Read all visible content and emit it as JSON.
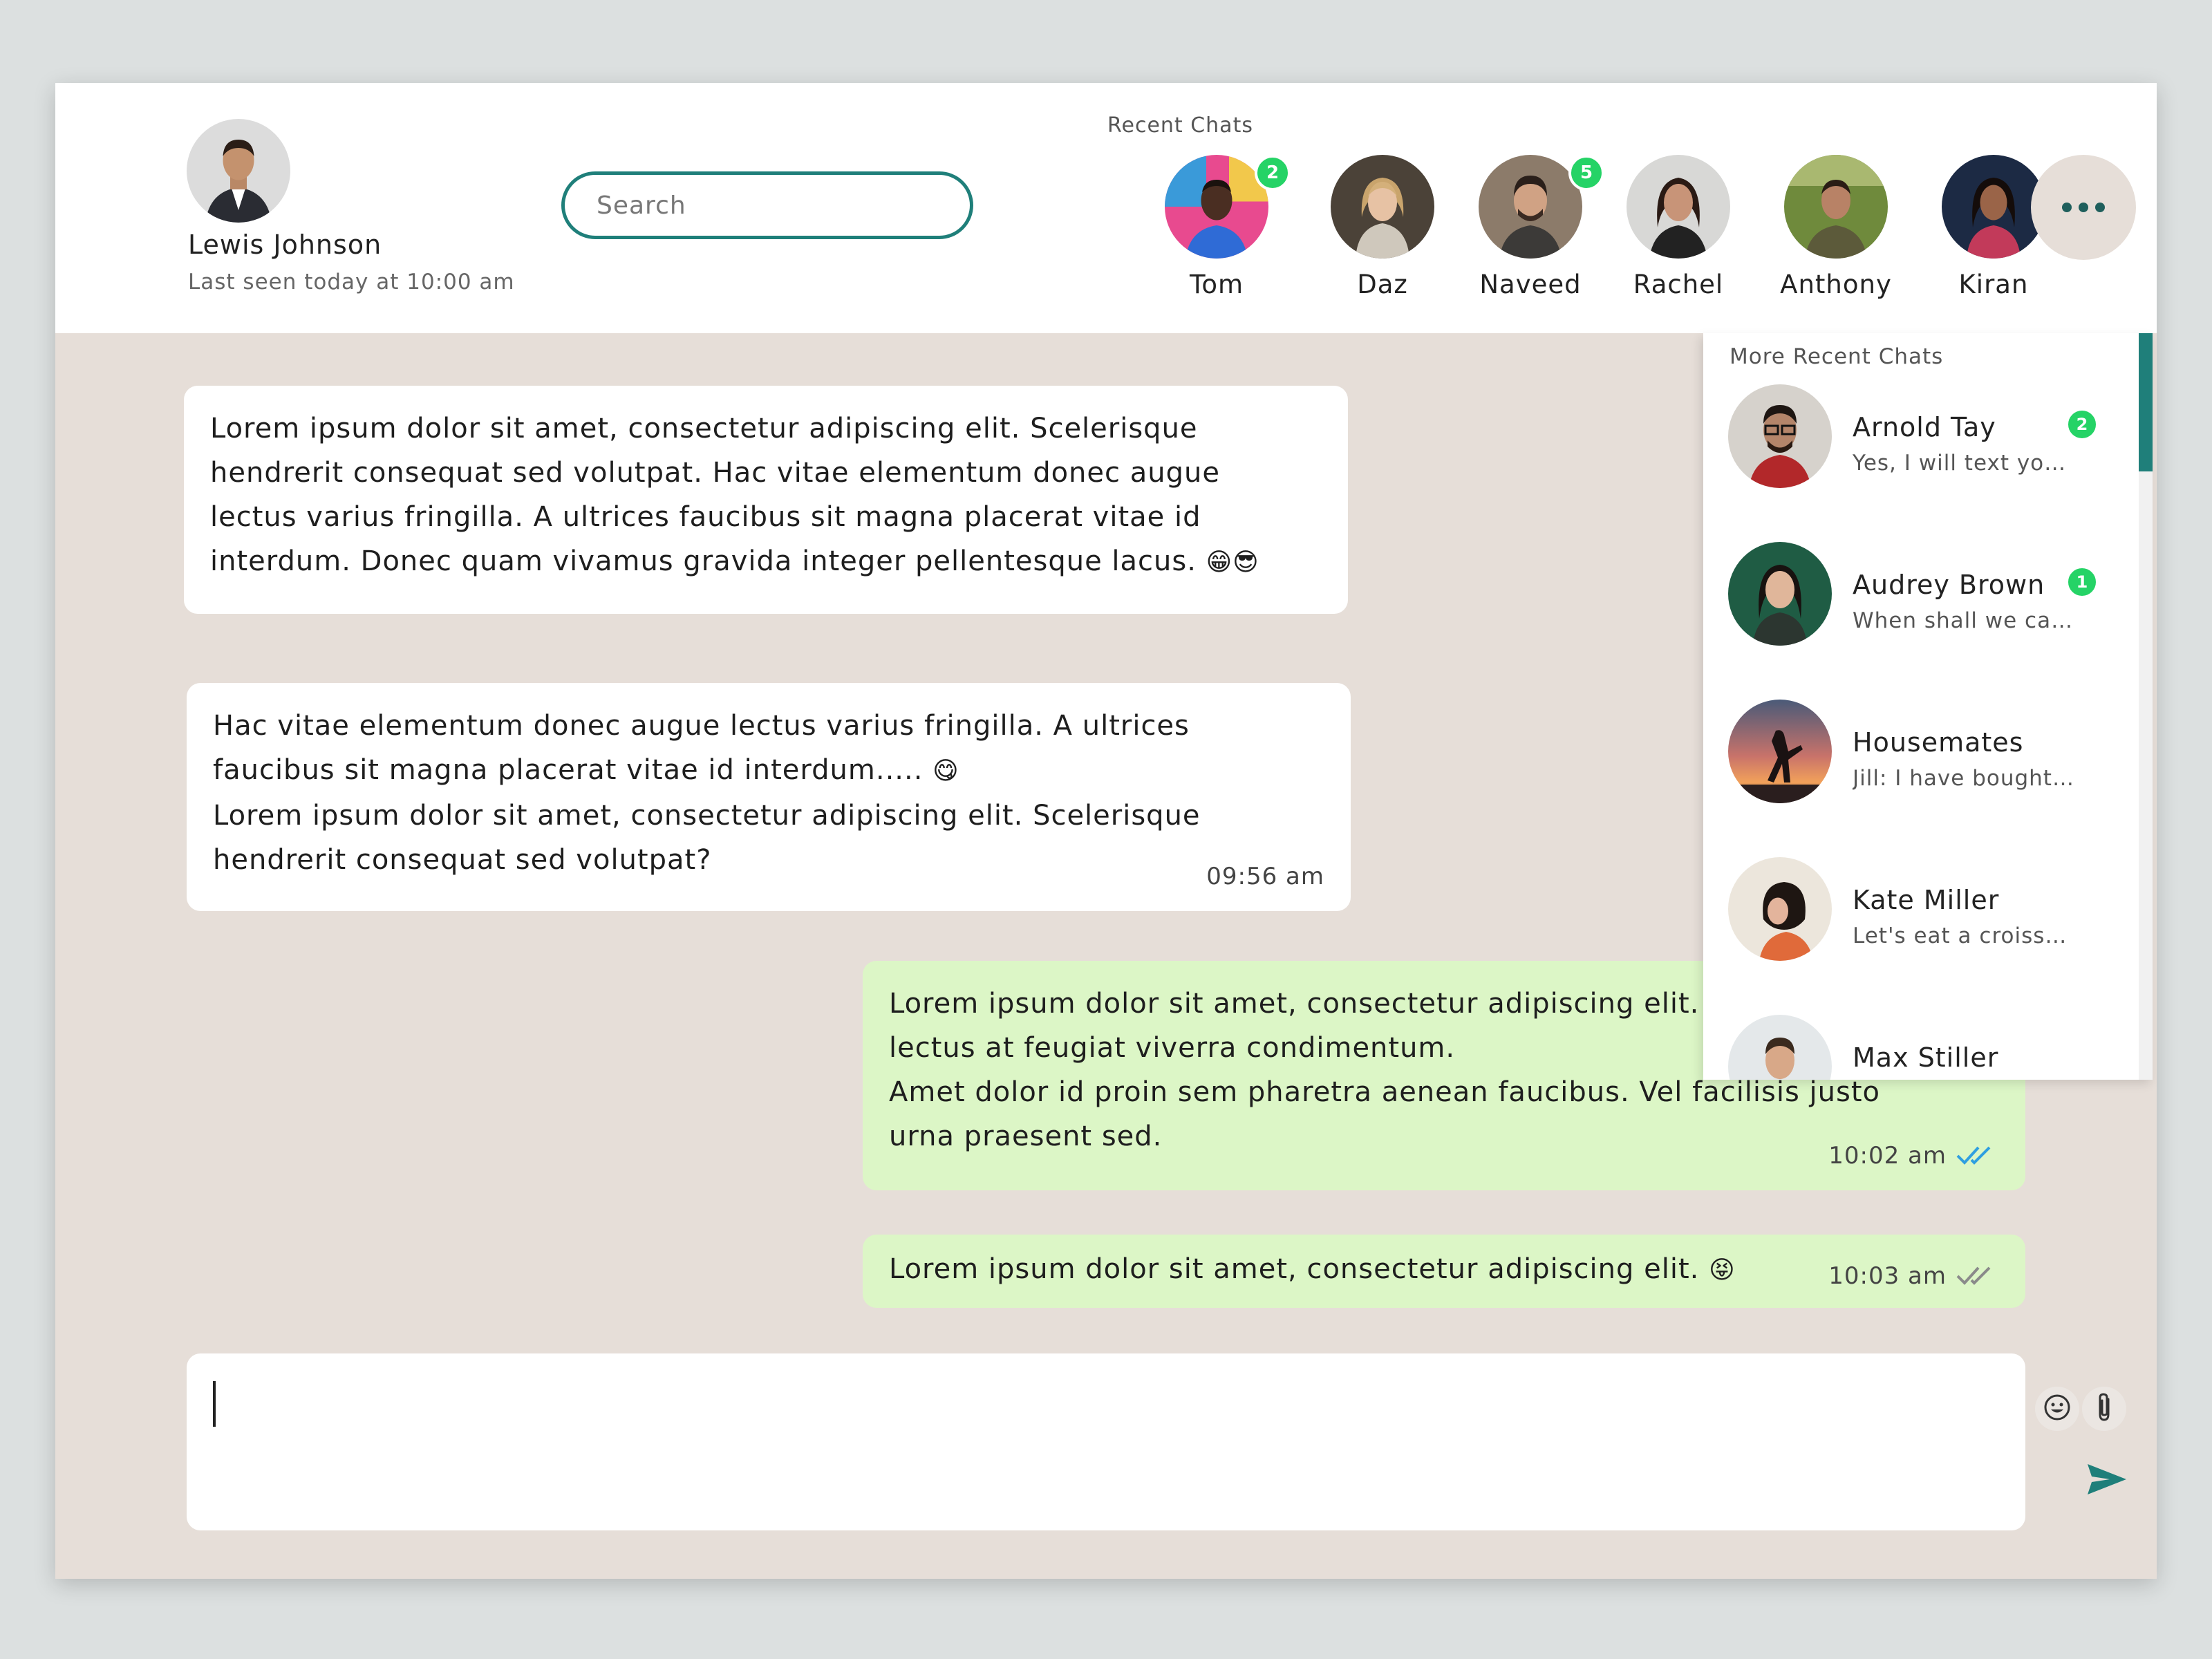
{
  "user": {
    "name": "Lewis Johnson",
    "status": "Last seen today at 10:00 am"
  },
  "search": {
    "placeholder": "Search",
    "value": ""
  },
  "recent_chats": {
    "label": "Recent Chats",
    "contacts": [
      {
        "name": "Tom",
        "badge": "2"
      },
      {
        "name": "Daz",
        "badge": ""
      },
      {
        "name": "Naveed",
        "badge": "5"
      },
      {
        "name": "Rachel",
        "badge": ""
      },
      {
        "name": "Anthony",
        "badge": ""
      },
      {
        "name": "Kiran",
        "badge": ""
      }
    ],
    "more_button_icon": "more-horizontal-icon"
  },
  "more_recent_chats": {
    "title": "More Recent Chats",
    "items": [
      {
        "name": "Arnold Tay",
        "preview": "Yes, I will text you...",
        "badge": "2"
      },
      {
        "name": "Audrey Brown",
        "preview": "When shall we catch up?",
        "badge": "1"
      },
      {
        "name": "Housemates",
        "preview": "Jill: I have bought the tickets",
        "badge": ""
      },
      {
        "name": "Kate Miller",
        "preview": "Let's eat a croissant",
        "badge": ""
      },
      {
        "name": "Max Stiller",
        "preview": "",
        "badge": ""
      }
    ]
  },
  "messages": [
    {
      "direction": "incoming",
      "lines": [
        "Lorem ipsum dolor sit amet, consectetur adipiscing elit. Scelerisque",
        "hendrerit consequat sed volutpat. Hac vitae elementum donec augue",
        "lectus varius fringilla. A ultrices faucibus sit magna placerat vitae id",
        "interdum. Donec quam vivamus gravida integer pellentesque lacus."
      ],
      "emoji": "😁😎",
      "time": ""
    },
    {
      "direction": "incoming",
      "lines": [
        "Hac vitae elementum donec augue lectus varius fringilla. A ultrices",
        "faucibus sit magna placerat vitae id interdum.....",
        "Lorem ipsum dolor sit amet, consectetur adipiscing elit. Scelerisque",
        "hendrerit consequat sed volutpat?"
      ],
      "emoji": "😋",
      "time": "09:56 am"
    },
    {
      "direction": "outgoing",
      "lines": [
        "Lorem ipsum dolor sit amet, consectetur adipiscing elit. Duis",
        "lectus at feugiat viverra condimentum.",
        "Amet dolor id proin sem pharetra aenean faucibus. Vel facilisis justo",
        "urna praesent sed."
      ],
      "time": "10:02 am",
      "read_status": "read",
      "tick_color": "#2f9fe0"
    },
    {
      "direction": "outgoing",
      "lines": [
        "Lorem ipsum dolor sit amet, consectetur adipiscing elit."
      ],
      "emoji": "😝",
      "time": "10:03 am",
      "read_status": "delivered",
      "tick_color": "#8a8a8a"
    }
  ],
  "composer": {
    "value": "",
    "emoji_icon": "smiley-icon",
    "attach_icon": "paperclip-icon",
    "send_icon": "send-icon"
  },
  "colors": {
    "accent": "#1f7f7a",
    "badge": "#25d366",
    "chat_background": "#e6ded8",
    "outgoing_bubble": "#dcf6c6",
    "incoming_bubble": "#ffffff"
  }
}
